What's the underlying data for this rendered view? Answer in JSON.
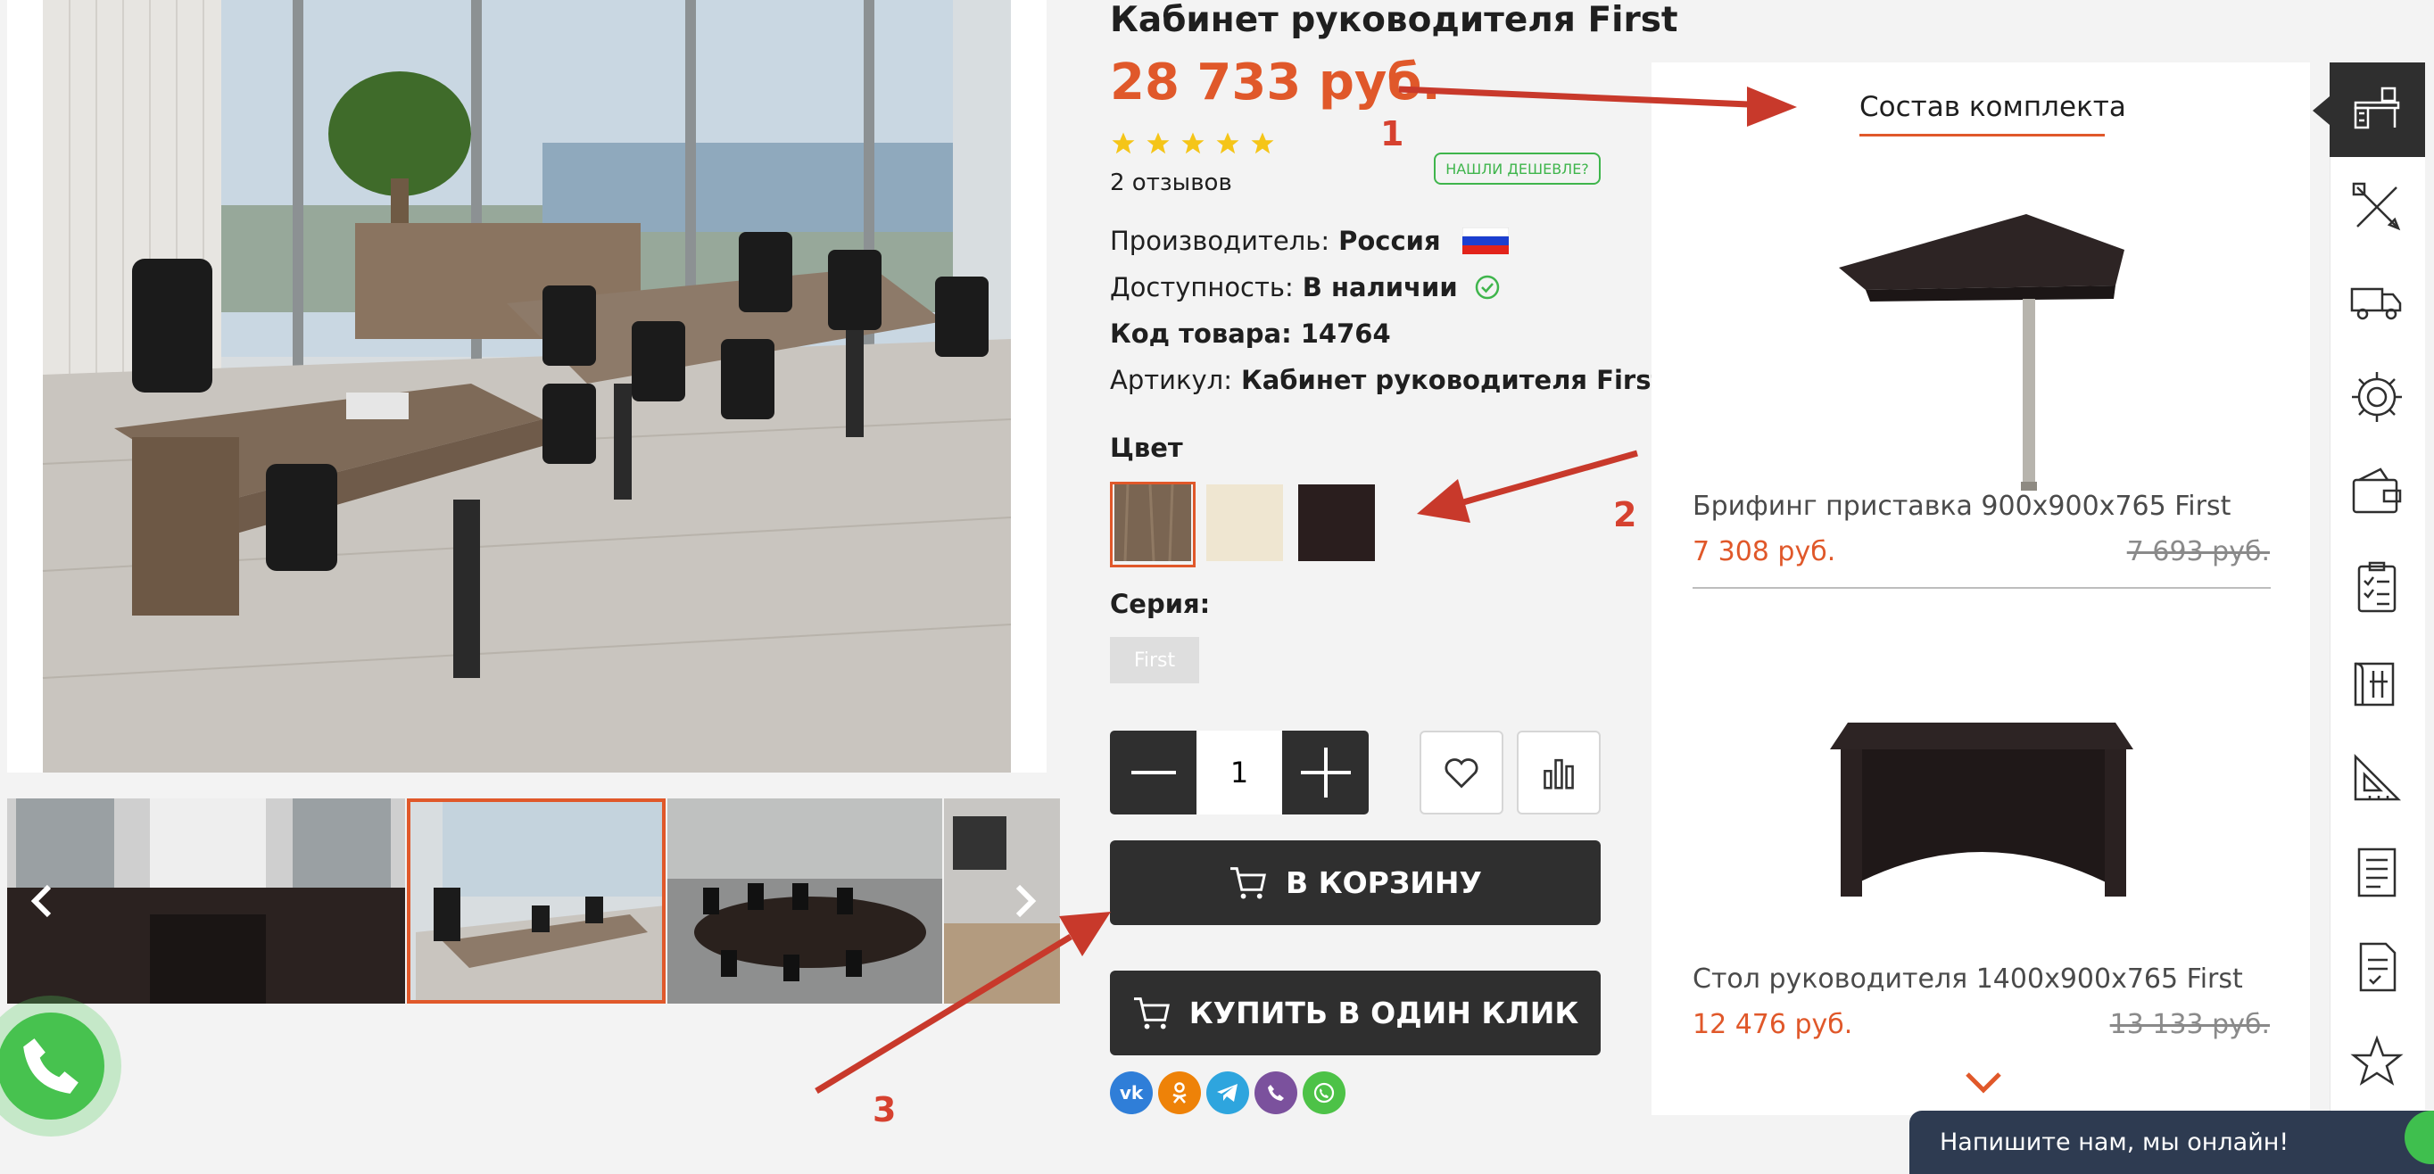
{
  "product": {
    "title": "Кабинет руководителя First",
    "price": "28 733 руб.",
    "rating": 5,
    "reviews": "2 отзывов",
    "cheaper_label": "НАШЛИ ДЕШЕВЛЕ?",
    "specs": [
      {
        "label": "Производитель:",
        "value": "Россия"
      },
      {
        "label": "Доступность:",
        "value": "В наличии"
      },
      {
        "label": "Код товара:",
        "value": "14764"
      },
      {
        "label": "Артикул:",
        "value": "Кабинет руководителя First"
      }
    ],
    "color_label": "Цвет",
    "colors": [
      "#7a6552",
      "#efe6d1",
      "#2a1e1e"
    ],
    "series_label": "Серия:",
    "series_value": "First",
    "quantity": "1",
    "cart_label": "В КОРЗИНУ",
    "one_click_label": "КУПИТЬ В ОДИН КЛИК"
  },
  "social": [
    "vk-icon",
    "odnoklassniki-icon",
    "telegram-icon",
    "viber-icon",
    "whatsapp-icon"
  ],
  "kit": {
    "title": "Состав комплекта",
    "items": [
      {
        "name": "Брифинг приставка 900x900x765 First",
        "price": "7 308 руб.",
        "old_price": "7 693 руб."
      },
      {
        "name": "Стол руководителя 1400x900x765 First",
        "price": "12 476 руб.",
        "old_price": "13 133 руб."
      }
    ]
  },
  "sidebar_icons": [
    "desk-icon",
    "tools-icon",
    "delivery-truck-icon",
    "gear-icon",
    "wallet-icon",
    "checklist-icon",
    "blueprint-icon",
    "ruler-triangle-icon",
    "document-icon",
    "contract-icon",
    "star-icon"
  ],
  "chat": {
    "label": "Напишите нам, мы онлайн!"
  },
  "annotations": [
    "1",
    "2",
    "3"
  ],
  "colors": {
    "accent": "#e0582a",
    "dark": "#2f2f2f",
    "annotation": "#c8392b",
    "green": "#3fb54c"
  }
}
